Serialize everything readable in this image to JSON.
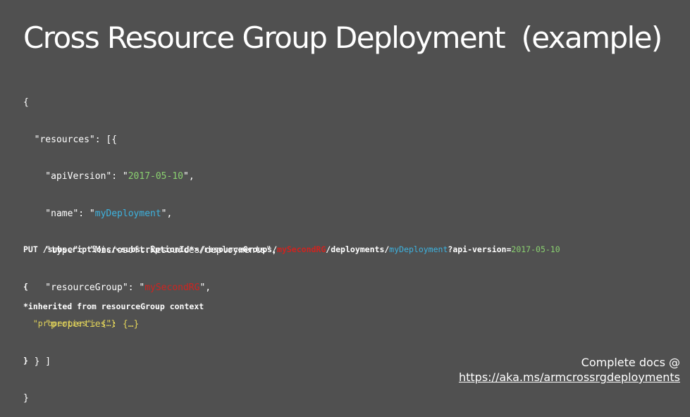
{
  "slide": {
    "title": "Cross Resource Group Deployment  (example)"
  },
  "json_template": {
    "open_brace": "{",
    "resources_open": "  \"resources\": [{",
    "api_version_key": "    \"apiVersion\": \"",
    "api_version_value": "2017-05-10",
    "api_version_end": "\",",
    "name_key": "    \"name\": \"",
    "name_value": "myDeployment",
    "name_end": "\",",
    "type_line": "    \"type\": \"Microsoft.Resources/deployments\",",
    "rg_key": "    \"resourceGroup\": \"",
    "rg_value": "mySecondRG",
    "rg_end": "\",",
    "properties_line": "    \"properties\": {…}",
    "resources_close": "  } ]",
    "close_brace": "}"
  },
  "rest_request": {
    "path_prefix": "PUT /subscriptions/<subscriptionId*>/resourceGroups/",
    "rg_value": "mySecondRG",
    "deployments_segment": "/deployments/",
    "name_value": "myDeployment",
    "query_prefix": "?api-version=",
    "api_version_value": "2017-05-10",
    "open_brace": "{",
    "properties_line": "  \"properties\": {…}",
    "close_brace": "}"
  },
  "footnote": "*inherited from resourceGroup context",
  "docs": {
    "label": "Complete docs @",
    "link_text": "https://aka.ms/armcrossrgdeployments"
  },
  "colors": {
    "background": "#505050",
    "text": "#ffffff",
    "value_green": "#8ad070",
    "value_blue": "#3db3e0",
    "value_red": "#d0231f",
    "json_yellow": "#e0d25a"
  }
}
